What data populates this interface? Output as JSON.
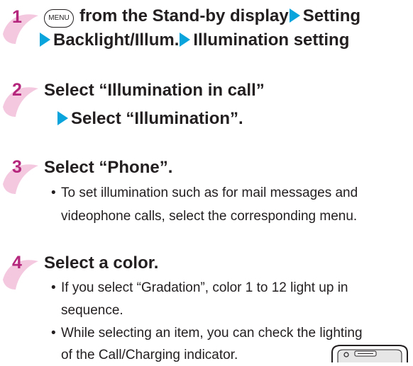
{
  "step1": {
    "number": "1",
    "key_label": "MENU",
    "line1_a": "from the Stand-by display",
    "line1_b": "Setting",
    "line2_a": "Backlight/Illum.",
    "line2_b": "Illumination setting"
  },
  "step2": {
    "number": "2",
    "line1": "Select “Illumination in call”",
    "line2": "Select “Illumination”."
  },
  "step3": {
    "number": "3",
    "title": "Select “Phone”.",
    "bullet_line1": "To set illumination such as for mail messages and",
    "bullet_line2": "videophone calls, select the corresponding menu."
  },
  "step4": {
    "number": "4",
    "title": "Select a color.",
    "bullet1_line1": "If you select “Gradation”, color 1 to 12 light up in",
    "bullet1_line2": "sequence.",
    "bullet2_line1": "While selecting an item, you can check the lighting",
    "bullet2_line2": "of the Call/Charging indicator."
  },
  "bullet_char": "•",
  "colors": {
    "accent_number": "#b5277d",
    "arrow": "#0aa4dc",
    "number_bg": "#f4c9e0"
  }
}
